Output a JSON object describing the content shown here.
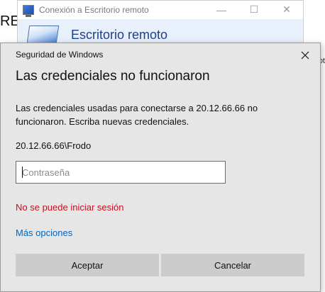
{
  "background": {
    "left_text": "RES",
    "right_fragment": "ot"
  },
  "rdc_window": {
    "title": "Conexión a Escritorio remoto",
    "header_title": "Escritorio remoto",
    "controls": {
      "minimize": "—",
      "maximize": "☐",
      "close": "✕"
    }
  },
  "dialog": {
    "caption": "Seguridad de Windows",
    "close_glyph": "✕",
    "heading": "Las credenciales no funcionaron",
    "message": "Las credenciales usadas para conectarse a 20.12.66.66 no funcionaron. Escriba nuevas credenciales.",
    "username": "20.12.66.66\\Frodo",
    "password": {
      "placeholder": "Contraseña",
      "value": ""
    },
    "error": "No se puede iniciar sesión",
    "more_options": "Más opciones",
    "buttons": {
      "ok": "Aceptar",
      "cancel": "Cancelar"
    }
  },
  "colors": {
    "dialog_bg": "#e6e6e6",
    "error": "#c50f1f",
    "link": "#0067c0",
    "button_bg": "#cccccc"
  }
}
